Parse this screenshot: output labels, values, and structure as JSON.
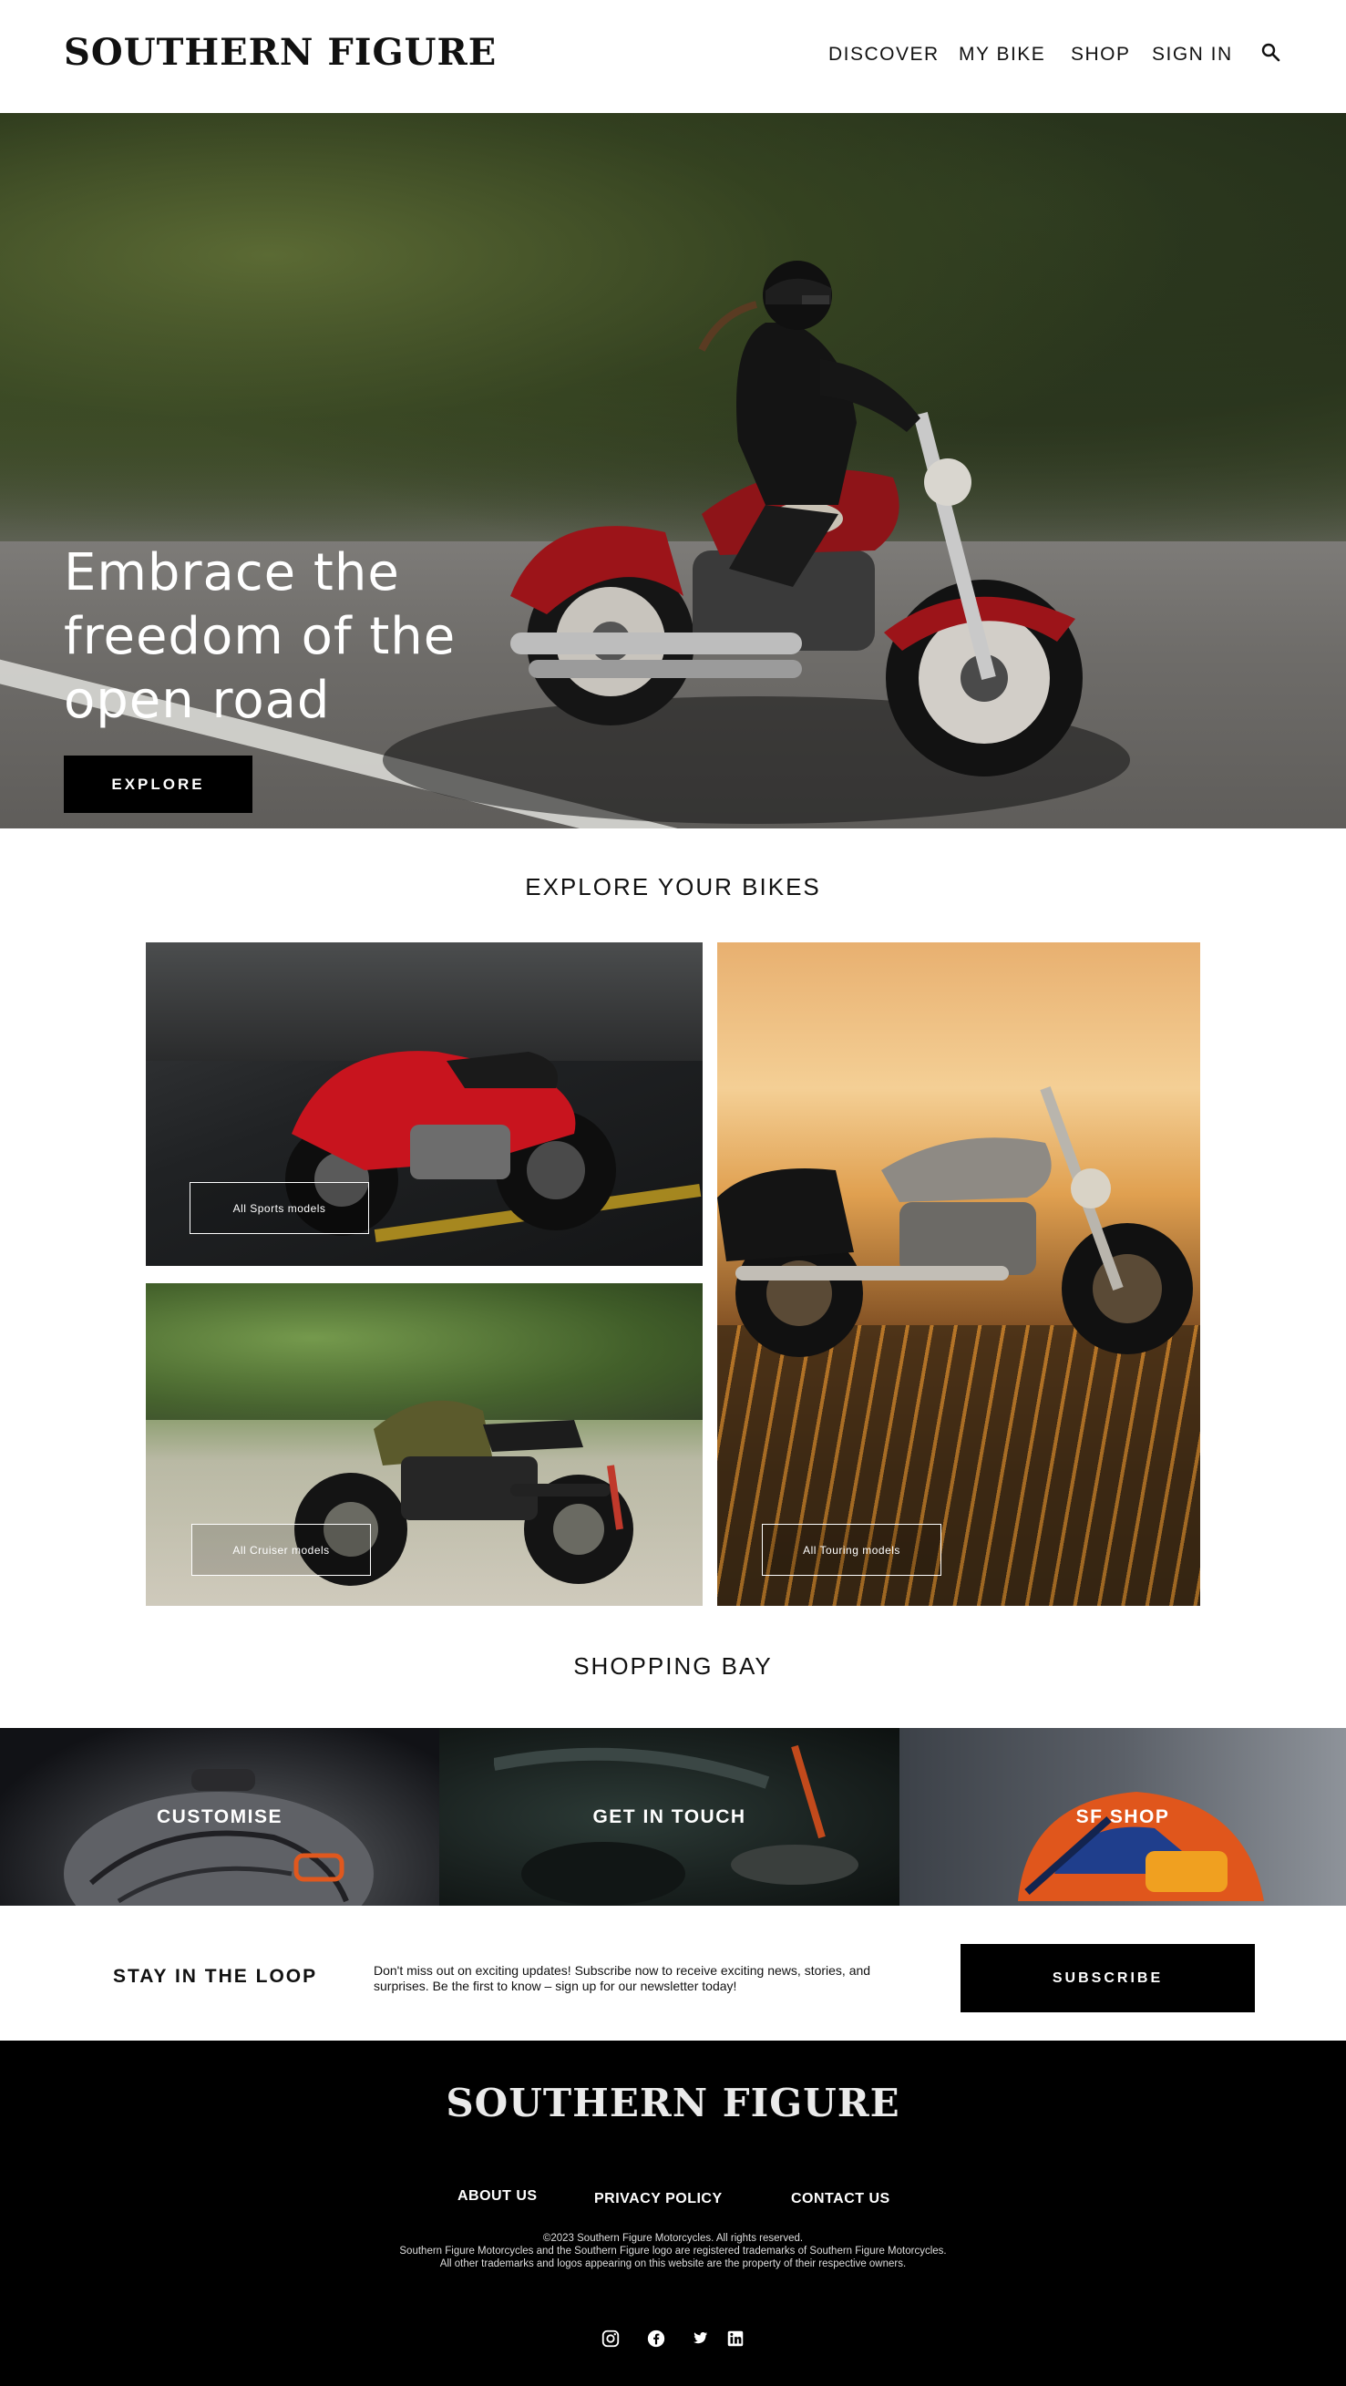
{
  "brand": {
    "name": "SOUTHERN FIGURE"
  },
  "nav": {
    "discover": "DISCOVER",
    "my_bike": "MY BIKE",
    "shop": "SHOP",
    "sign_in": "SIGN IN",
    "search_icon": "search-icon"
  },
  "hero": {
    "headline": "Embrace the freedom of the open road",
    "cta": "EXPLORE"
  },
  "explore": {
    "title": "EXPLORE YOUR BIKES",
    "tiles": [
      {
        "label": "All Sports  models",
        "accent": "#c8141e"
      },
      {
        "label": "All Cruiser  models",
        "accent": "#5b5a2c"
      },
      {
        "label": "All Touring  models",
        "accent": "#e0a050"
      }
    ]
  },
  "shopping": {
    "title": "SHOPPING BAY",
    "panels": [
      {
        "label": "CUSTOMISE"
      },
      {
        "label": "GET IN TOUCH"
      },
      {
        "label": "SF SHOP"
      }
    ]
  },
  "newsletter": {
    "title": "STAY IN THE LOOP",
    "description": "Don't miss out on exciting updates! Subscribe now to receive exciting news, stories, and surprises. Be the first to know – sign up for our newsletter today!",
    "cta": "SUBSCRIBE"
  },
  "footer": {
    "logo": "SOUTHERN FIGURE",
    "links": {
      "about": "ABOUT US",
      "privacy": "PRIVACY POLICY",
      "contact": "CONTACT US"
    },
    "legal": [
      "©2023 Southern Figure Motorcycles. All rights reserved.",
      "Southern Figure Motorcycles and the Southern Figure logo are registered trademarks of Southern Figure Motorcycles.",
      "All other trademarks and logos appearing on this website are the property of their respective owners."
    ],
    "social_icons": [
      "instagram-icon",
      "facebook-icon",
      "twitter-icon",
      "linkedin-icon"
    ]
  }
}
